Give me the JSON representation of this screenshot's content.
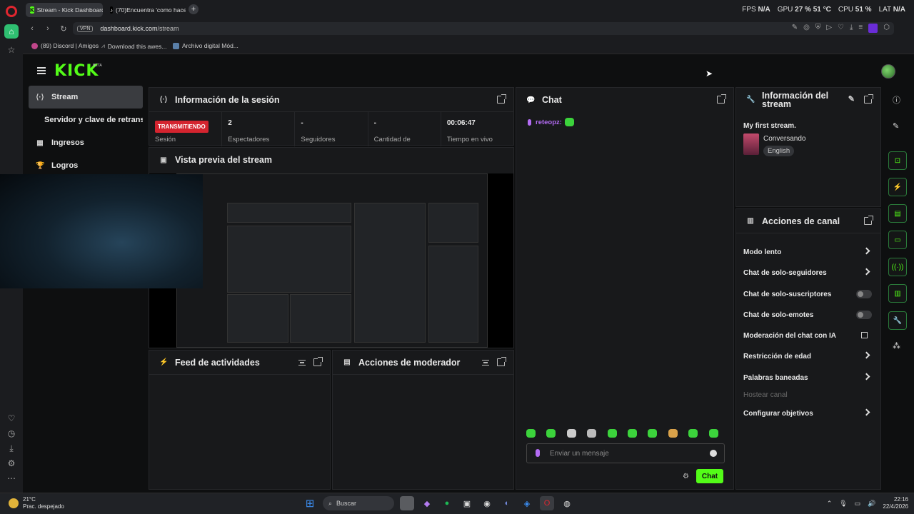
{
  "browser": {
    "tabs": [
      {
        "title": "Stream - Kick Dashboard"
      },
      {
        "title": "(70)Encuentra 'como hace"
      }
    ],
    "stats": {
      "fps_label": "FPS",
      "fps_value": "N/A",
      "gpu_label": "GPU",
      "gpu_value": "27 % 51 °C",
      "cpu_label": "CPU",
      "cpu_value": "51 %",
      "lat_label": "LAT",
      "lat_value": "N/A"
    },
    "vpn": "VPN",
    "url_host": "dashboard.kick.com",
    "url_path": "/stream",
    "bookmarks": [
      "(89) Discord | Amigos",
      "Download this awes...",
      "Archivo digital Mód..."
    ]
  },
  "kick": {
    "logo": "KICK",
    "beta": "BETA",
    "nav": [
      {
        "label": "Stream",
        "icon": "broadcast-icon"
      },
      {
        "label": "Servidor y clave de retransn"
      },
      {
        "label": "Ingresos",
        "icon": "revenue-icon"
      },
      {
        "label": "Logros",
        "icon": "trophy-icon"
      }
    ]
  },
  "session": {
    "title": "Información de la sesión",
    "cells": [
      {
        "value": "TRANSMITIENDO",
        "label": "Sesión"
      },
      {
        "value": "2",
        "label": "Espectadores"
      },
      {
        "value": "-",
        "label": "Seguidores"
      },
      {
        "value": "-",
        "label": "Cantidad de"
      },
      {
        "value": "00:06:47",
        "label": "Tiempo en vivo"
      }
    ]
  },
  "preview": {
    "title": "Vista previa del stream"
  },
  "feed": {
    "title": "Feed de actividades"
  },
  "mod_actions": {
    "title": "Acciones de moderador"
  },
  "chat": {
    "title": "Chat",
    "message_user": "reteopz:",
    "input_placeholder": "Enviar un mensaje",
    "send_label": "Chat"
  },
  "stream_info": {
    "title": "Información del stream",
    "stream_title": "My first stream.",
    "category": "Conversando",
    "language": "English"
  },
  "channel_actions": {
    "title": "Acciones de canal",
    "items": [
      {
        "label": "Modo lento",
        "control": "chevron"
      },
      {
        "label": "Chat de solo-seguidores",
        "control": "chevron"
      },
      {
        "label": "Chat de solo-suscriptores",
        "control": "toggle",
        "enabled": false
      },
      {
        "label": "Chat de solo-emotes",
        "control": "toggle",
        "enabled": false
      },
      {
        "label": "Moderación del chat con IA",
        "control": "external"
      },
      {
        "label": "Restricción de edad",
        "control": "chevron"
      },
      {
        "label": "Palabras baneadas",
        "control": "chevron"
      },
      {
        "label": "Hostear canal",
        "control": "none",
        "disabled": true
      },
      {
        "label": "Configurar objetivos",
        "control": "chevron"
      }
    ]
  },
  "taskbar": {
    "temp": "21°C",
    "weather": "Prac. despejado",
    "search": "Buscar",
    "time": "22:16",
    "date": "22/4/2026"
  },
  "colors": {
    "kick_green": "#53fc18",
    "live_red": "#d4242f",
    "chat_user": "#b46cf5"
  }
}
